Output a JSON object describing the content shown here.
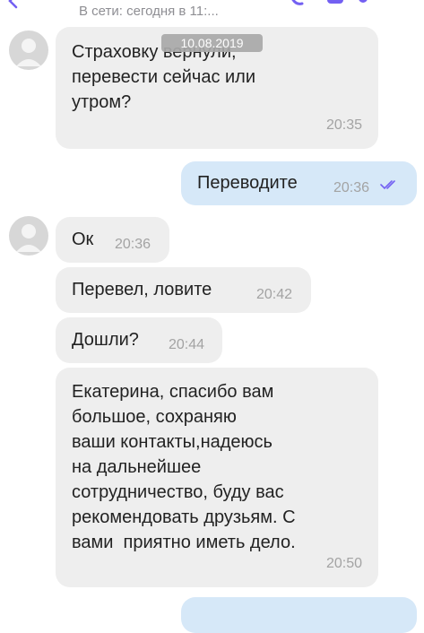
{
  "header": {
    "status": "В сети: сегодня в 11:..."
  },
  "date_separator": "10.08.2019",
  "messages": [
    {
      "text": "Страховку вернули,\nперевести сейчас или\nутром?",
      "time": "20:35"
    },
    {
      "text": "Переводите",
      "time": "20:36",
      "status_icon": "double-check-icon"
    },
    {
      "text": "Ок",
      "time": "20:36"
    },
    {
      "text": "Перевел, ловите",
      "time": "20:42"
    },
    {
      "text": "Дошли?",
      "time": "20:44"
    },
    {
      "text": "Екатерина, спасибо вам\nбольшое, сохраняю\nваши контакты,надеюсь\nна дальнейшее\nсотрудничество, буду вас\nрекомендовать друзьям. С\nвами  приятно иметь дело.",
      "time": "20:50"
    }
  ],
  "colors": {
    "incoming_bubble": "#eeeeee",
    "outgoing_bubble": "#d6e8f8",
    "accent": "#7360f2"
  }
}
